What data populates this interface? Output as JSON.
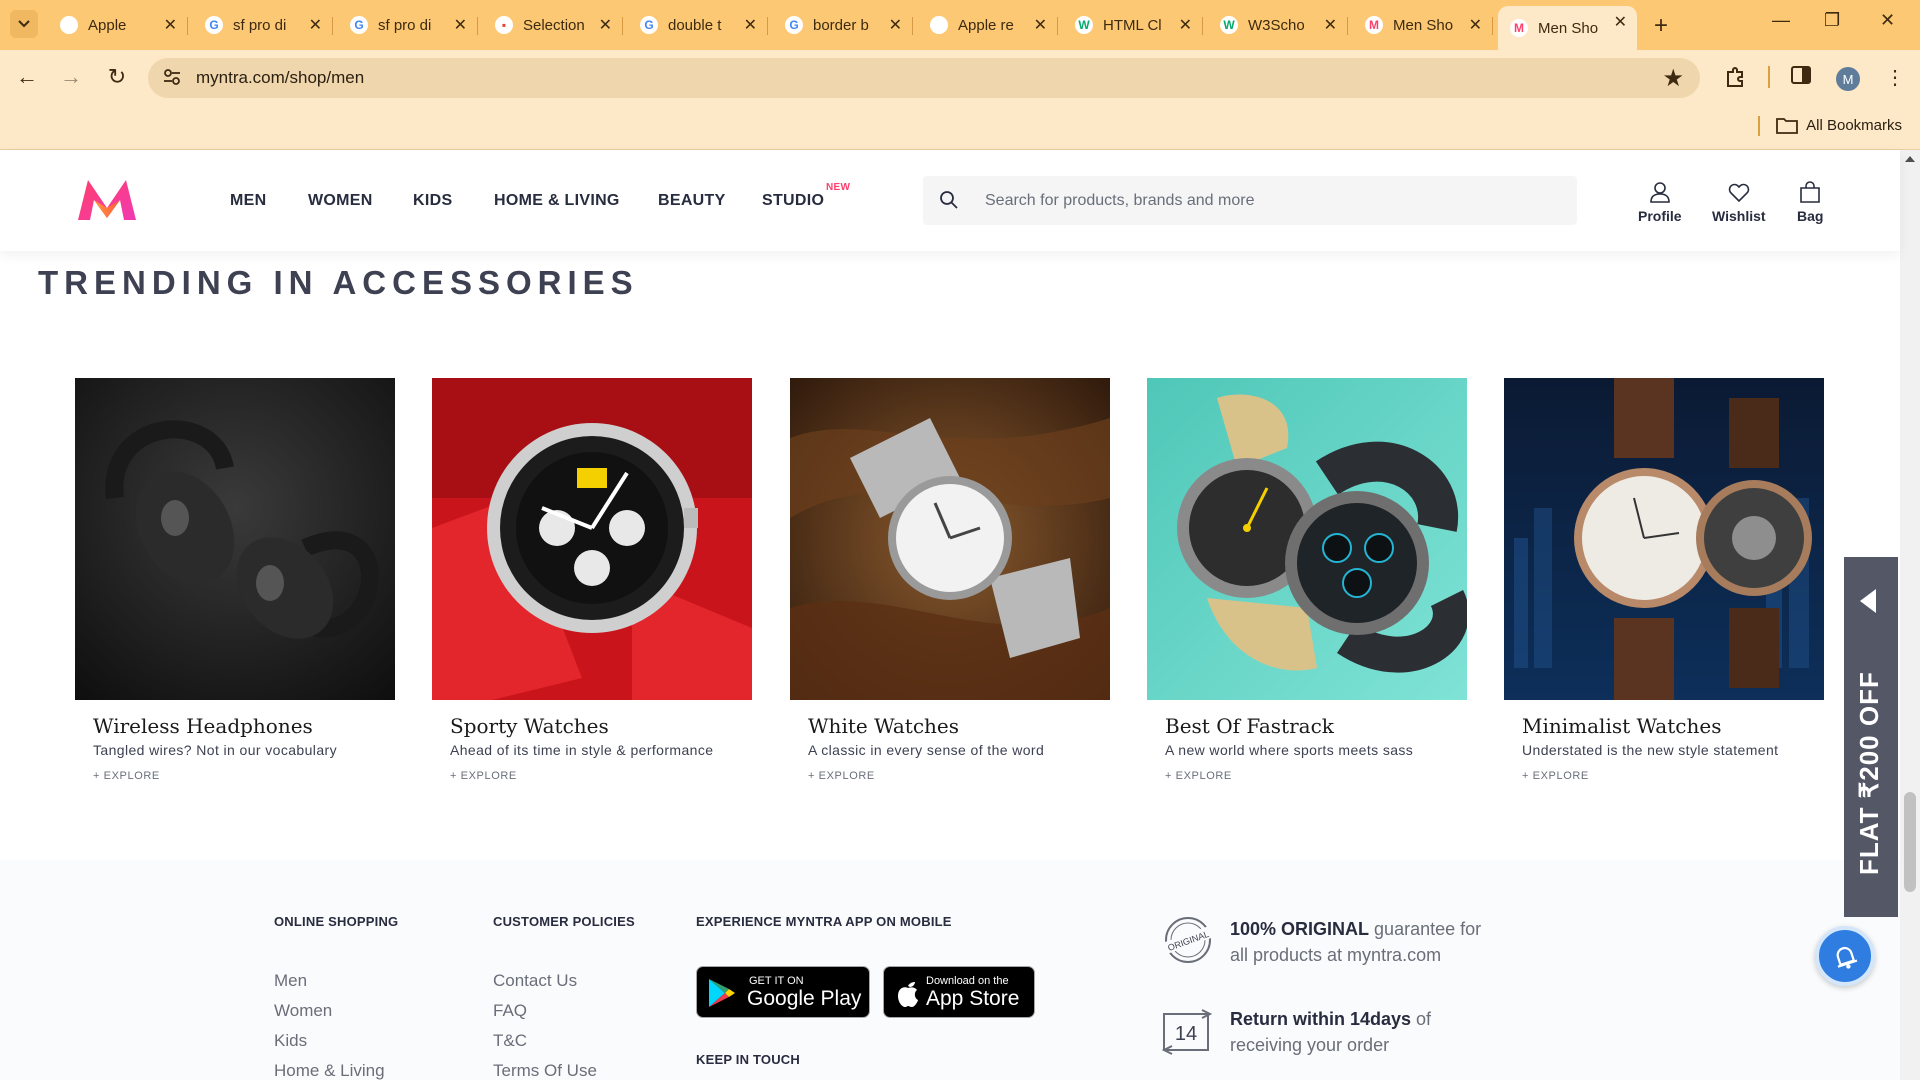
{
  "browser": {
    "tabs": [
      {
        "title": "Apple",
        "fav_color": "#5f6368",
        "fav_glyph": ""
      },
      {
        "title": "sf pro di",
        "fav_color": "#4285f4",
        "fav_glyph": "G"
      },
      {
        "title": "sf pro di",
        "fav_color": "#4285f4",
        "fav_glyph": "G"
      },
      {
        "title": "Selection",
        "fav_color": "#e94235",
        "fav_glyph": "▪"
      },
      {
        "title": "double t",
        "fav_color": "#4285f4",
        "fav_glyph": "G"
      },
      {
        "title": "border b",
        "fav_color": "#4285f4",
        "fav_glyph": "G"
      },
      {
        "title": "Apple re",
        "fav_color": "#202124",
        "fav_glyph": ""
      },
      {
        "title": "HTML Cl",
        "fav_color": "#04aa6d",
        "fav_glyph": "W"
      },
      {
        "title": "W3Scho",
        "fav_color": "#04aa6d",
        "fav_glyph": "W"
      },
      {
        "title": "Men Sho",
        "fav_color": "#ff3f6c",
        "fav_glyph": "M"
      },
      {
        "title": "Men Sho",
        "fav_color": "#ff3f6c",
        "fav_glyph": "M"
      }
    ],
    "url": "myntra.com/shop/men",
    "bookmarks_label": "All Bookmarks",
    "avatar_letter": "M"
  },
  "header": {
    "nav": [
      "MEN",
      "WOMEN",
      "KIDS",
      "HOME & LIVING",
      "BEAUTY",
      "STUDIO"
    ],
    "studio_badge": "NEW",
    "search_placeholder": "Search for products, brands and more",
    "actions": {
      "profile": "Profile",
      "wishlist": "Wishlist",
      "bag": "Bag"
    }
  },
  "section": {
    "title": "TRENDING IN ACCESSORIES",
    "cards": [
      {
        "name": "Wireless Headphones",
        "tagline": "Tangled wires? Not in our vocabulary",
        "cta": "+ EXPLORE"
      },
      {
        "name": "Sporty Watches",
        "tagline": "Ahead of its time in style & performance",
        "cta": "+ EXPLORE"
      },
      {
        "name": "White Watches",
        "tagline": "A classic in every sense of the word",
        "cta": "+ EXPLORE"
      },
      {
        "name": "Best Of Fastrack",
        "tagline": "A new world where sports meets sass",
        "cta": "+ EXPLORE"
      },
      {
        "name": "Minimalist Watches",
        "tagline": "Understated is the new style statement",
        "cta": "+ EXPLORE"
      }
    ]
  },
  "footer": {
    "online_shopping": {
      "heading": "ONLINE SHOPPING",
      "links": [
        "Men",
        "Women",
        "Kids",
        "Home & Living"
      ]
    },
    "customer_policies": {
      "heading": "CUSTOMER POLICIES",
      "links": [
        "Contact Us",
        "FAQ",
        "T&C",
        "Terms Of Use"
      ]
    },
    "app": {
      "heading": "EXPERIENCE MYNTRA APP ON MOBILE",
      "google": {
        "small": "GET IT ON",
        "big": "Google Play"
      },
      "apple": {
        "small": "Download on the",
        "big": "App Store"
      },
      "keep_in_touch": "KEEP IN TOUCH"
    },
    "original": {
      "bold": "100% ORIGINAL",
      "rest1": " guarantee for",
      "rest2": "all products at myntra.com",
      "badge": "ORIGINAL"
    },
    "returns": {
      "bold": "Return within 14days",
      "rest1": " of",
      "rest2": "receiving your order",
      "badge": "14"
    }
  },
  "offer_tab": "FLAT ₹200 OFF",
  "colors": {
    "brand_pink": "#ff3f6c",
    "brand_orange": "#f13ab1",
    "chrome_tab": "#fcc873",
    "chrome_toolbar": "#fde9c8"
  }
}
